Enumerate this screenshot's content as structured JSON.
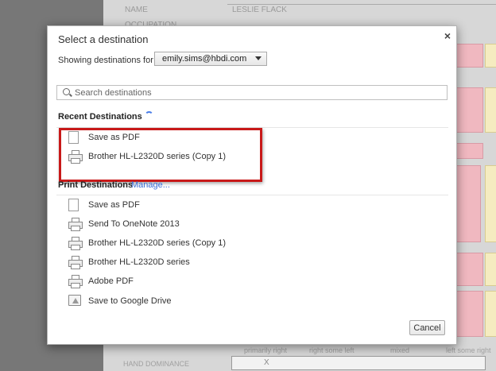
{
  "background": {
    "name_label": "NAME",
    "name_value": "LESLIE FLACK",
    "occupation_label": "OCCUPATION",
    "hand_dominance_label": "HAND DOMINANCE",
    "columns": [
      "primarily right",
      "right some left",
      "mixed",
      "left some right"
    ],
    "x_mark": "X"
  },
  "dialog": {
    "title": "Select a destination",
    "close_glyph": "×",
    "showing_label": "Showing destinations for",
    "account": "emily.sims@hbdi.com",
    "search_placeholder": "Search destinations",
    "recent_heading": "Recent Destinations",
    "recent": [
      {
        "label": "Save as PDF",
        "icon": "pdf-icon"
      },
      {
        "label": "Brother HL-L2320D series (Copy 1)",
        "icon": "printer-icon"
      }
    ],
    "print_heading": "Print Destinations",
    "manage_link": "Manage...",
    "print": [
      {
        "label": "Save as PDF",
        "icon": "pdf-icon"
      },
      {
        "label": "Send To OneNote 2013",
        "icon": "printer-icon"
      },
      {
        "label": "Brother HL-L2320D series (Copy 1)",
        "icon": "printer-icon"
      },
      {
        "label": "Brother HL-L2320D series",
        "icon": "printer-icon"
      },
      {
        "label": "Adobe PDF",
        "icon": "printer-icon"
      },
      {
        "label": "Save to Google Drive",
        "icon": "google-drive-icon"
      }
    ],
    "cancel_label": "Cancel",
    "highlight_color": "#c81919",
    "link_color": "#3b6fd8"
  }
}
